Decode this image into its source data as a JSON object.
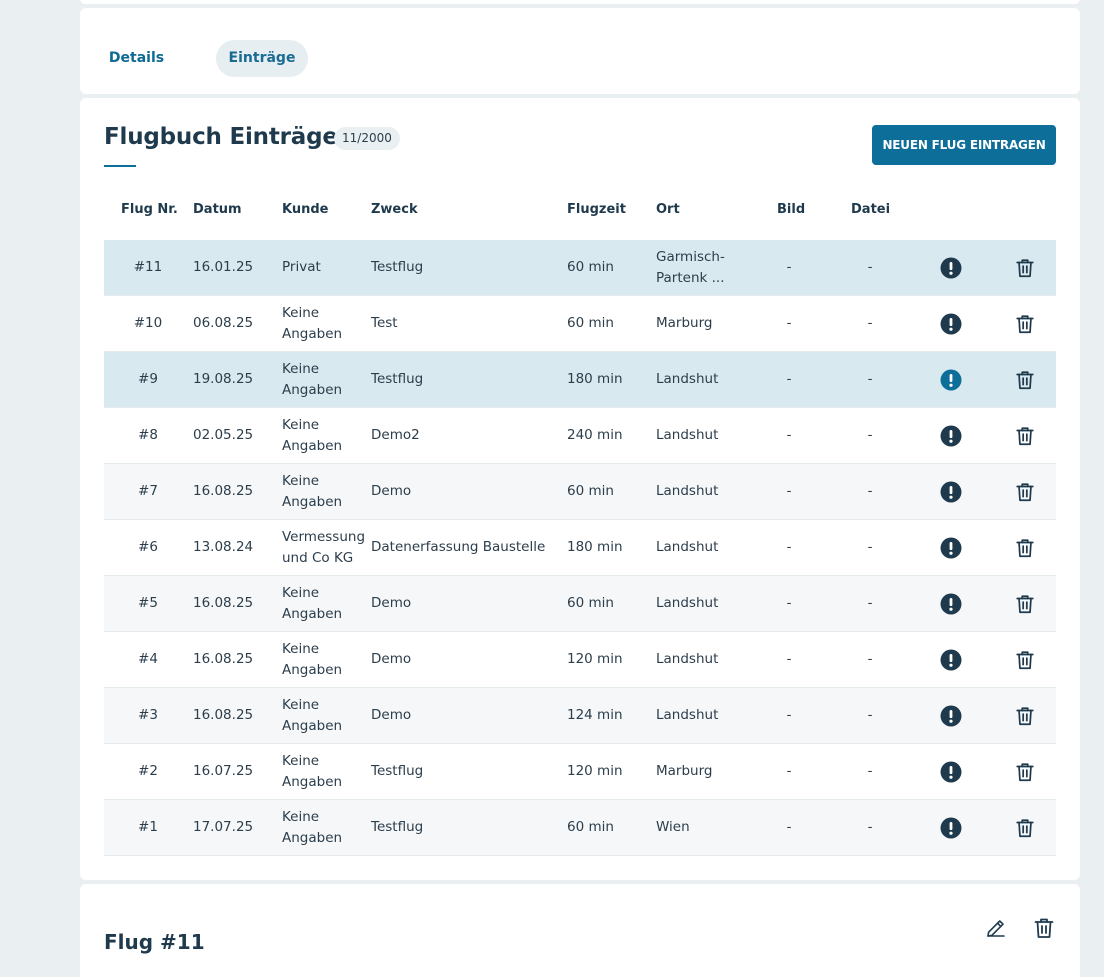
{
  "tabs": {
    "details": "Details",
    "entries": "Einträge"
  },
  "section": {
    "title": "Flugbuch Einträge",
    "count": "11/2000",
    "new_button": "NEUEN FLUG EINTRAGEN"
  },
  "table": {
    "headers": {
      "nr": "Flug Nr.",
      "datum": "Datum",
      "kunde": "Kunde",
      "zweck": "Zweck",
      "zeit": "Flugzeit",
      "ort": "Ort",
      "bild": "Bild",
      "datei": "Datei"
    },
    "rows": [
      {
        "nr": "#11",
        "datum": "16.01.25",
        "kunde": "Privat",
        "zweck": "Testflug",
        "zeit": "60 min",
        "ort": "Garmisch-\nPartenk ...",
        "bild": "-",
        "datei": "-",
        "selected": true
      },
      {
        "nr": "#10",
        "datum": "06.08.25",
        "kunde": "Keine\nAngaben",
        "zweck": "Test",
        "zeit": "60 min",
        "ort": "Marburg",
        "bild": "-",
        "datei": "-"
      },
      {
        "nr": "#9",
        "datum": "19.08.25",
        "kunde": "Keine\nAngaben",
        "zweck": "Testflug",
        "zeit": "180 min",
        "ort": "Landshut",
        "bild": "-",
        "datei": "-",
        "selected": true,
        "hovered": true
      },
      {
        "nr": "#8",
        "datum": "02.05.25",
        "kunde": "Keine\nAngaben",
        "zweck": "Demo2",
        "zeit": "240 min",
        "ort": "Landshut",
        "bild": "-",
        "datei": "-"
      },
      {
        "nr": "#7",
        "datum": "16.08.25",
        "kunde": "Keine\nAngaben",
        "zweck": "Demo",
        "zeit": "60 min",
        "ort": "Landshut",
        "bild": "-",
        "datei": "-"
      },
      {
        "nr": "#6",
        "datum": "13.08.24",
        "kunde": "Vermessung\nund Co KG",
        "zweck": "Datenerfassung Baustelle",
        "zeit": "180 min",
        "ort": "Landshut",
        "bild": "-",
        "datei": "-"
      },
      {
        "nr": "#5",
        "datum": "16.08.25",
        "kunde": "Keine\nAngaben",
        "zweck": "Demo",
        "zeit": "60 min",
        "ort": "Landshut",
        "bild": "-",
        "datei": "-"
      },
      {
        "nr": "#4",
        "datum": "16.08.25",
        "kunde": "Keine\nAngaben",
        "zweck": "Demo",
        "zeit": "120 min",
        "ort": "Landshut",
        "bild": "-",
        "datei": "-"
      },
      {
        "nr": "#3",
        "datum": "16.08.25",
        "kunde": "Keine\nAngaben",
        "zweck": "Demo",
        "zeit": "124 min",
        "ort": "Landshut",
        "bild": "-",
        "datei": "-"
      },
      {
        "nr": "#2",
        "datum": "16.07.25",
        "kunde": "Keine\nAngaben",
        "zweck": "Testflug",
        "zeit": "120 min",
        "ort": "Marburg",
        "bild": "-",
        "datei": "-"
      },
      {
        "nr": "#1",
        "datum": "17.07.25",
        "kunde": "Keine\nAngaben",
        "zweck": "Testflug",
        "zeit": "60 min",
        "ort": "Wien",
        "bild": "-",
        "datei": "-"
      }
    ]
  },
  "detail": {
    "title": "Flug #11"
  },
  "icons": {
    "info": "exclamation-circle-icon",
    "delete": "trash-icon",
    "edit": "pencil-icon"
  },
  "colors": {
    "accent": "#0e6e9a",
    "dark": "#1f3a4d",
    "selected_row": "#d8e9ef",
    "background": "#eaeff2"
  }
}
